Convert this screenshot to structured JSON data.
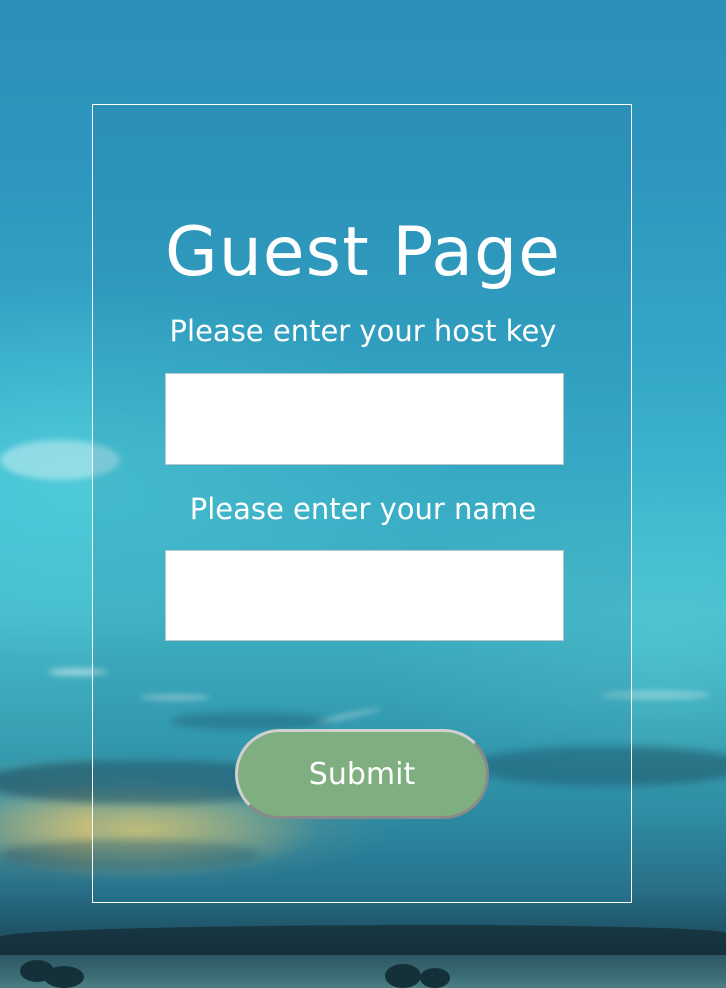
{
  "page": {
    "title": "Guest Page"
  },
  "form": {
    "host_key_label": "Please enter your host key",
    "host_key_value": "",
    "name_label": "Please enter your name",
    "name_value": "",
    "submit_label": "Submit"
  },
  "colors": {
    "panel_border": "#ffffff",
    "submit_background": "#7fae80",
    "text": "#ffffff",
    "input_background": "#ffffff"
  }
}
